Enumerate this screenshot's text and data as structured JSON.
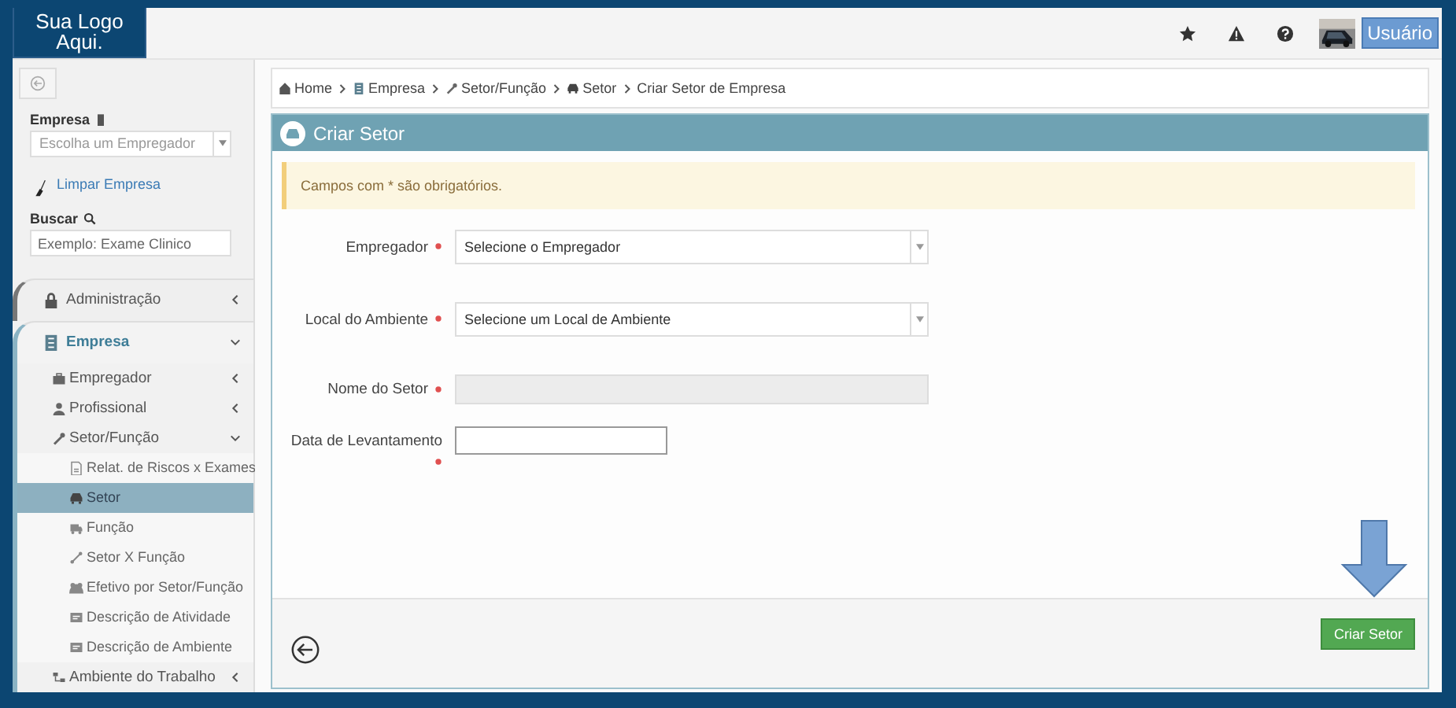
{
  "logo": {
    "text": "Sua Logo Aqui."
  },
  "header": {
    "user_button": "Usuário"
  },
  "sidebar": {
    "empresa_label": "Empresa",
    "empresa_select": {
      "placeholder": "Escolha um Empregador"
    },
    "clear_link": "Limpar Empresa",
    "search_label": "Buscar",
    "search": {
      "placeholder": "Exemplo: Exame Clinico"
    },
    "menu": [
      {
        "label": "Administração",
        "expanded": false
      },
      {
        "label": "Empresa",
        "expanded": true,
        "children": [
          {
            "label": "Empregador",
            "expanded": false
          },
          {
            "label": "Profissional",
            "expanded": false
          },
          {
            "label": "Setor/Função",
            "expanded": true,
            "children": [
              {
                "label": "Relat. de Riscos x Exames",
                "selected": false
              },
              {
                "label": "Setor",
                "selected": true
              },
              {
                "label": "Função",
                "selected": false
              },
              {
                "label": "Setor X Função",
                "selected": false
              },
              {
                "label": "Efetivo por Setor/Função",
                "selected": false
              },
              {
                "label": "Descrição de Atividade",
                "selected": false
              },
              {
                "label": "Descrição de Ambiente",
                "selected": false
              }
            ]
          },
          {
            "label": "Ambiente do Trabalho",
            "expanded": false
          }
        ]
      }
    ]
  },
  "breadcrumb": [
    "Home",
    "Empresa",
    "Setor/Função",
    "Setor",
    "Criar Setor de Empresa"
  ],
  "panel": {
    "title": "Criar Setor",
    "alert": "Campos com * são obrigatórios.",
    "fields": [
      {
        "label": "Empregador",
        "kind": "select",
        "placeholder": "Selecione o Empregador",
        "required": true
      },
      {
        "label": "Local do Ambiente",
        "kind": "select",
        "placeholder": "Selecione um Local de Ambiente",
        "required": true
      },
      {
        "label": "Nome do Setor",
        "kind": "text",
        "required": true,
        "disabled": true
      },
      {
        "label": "Data de Levantamento",
        "kind": "date",
        "required": true,
        "disabled": false
      }
    ],
    "submit": "Criar Setor"
  }
}
